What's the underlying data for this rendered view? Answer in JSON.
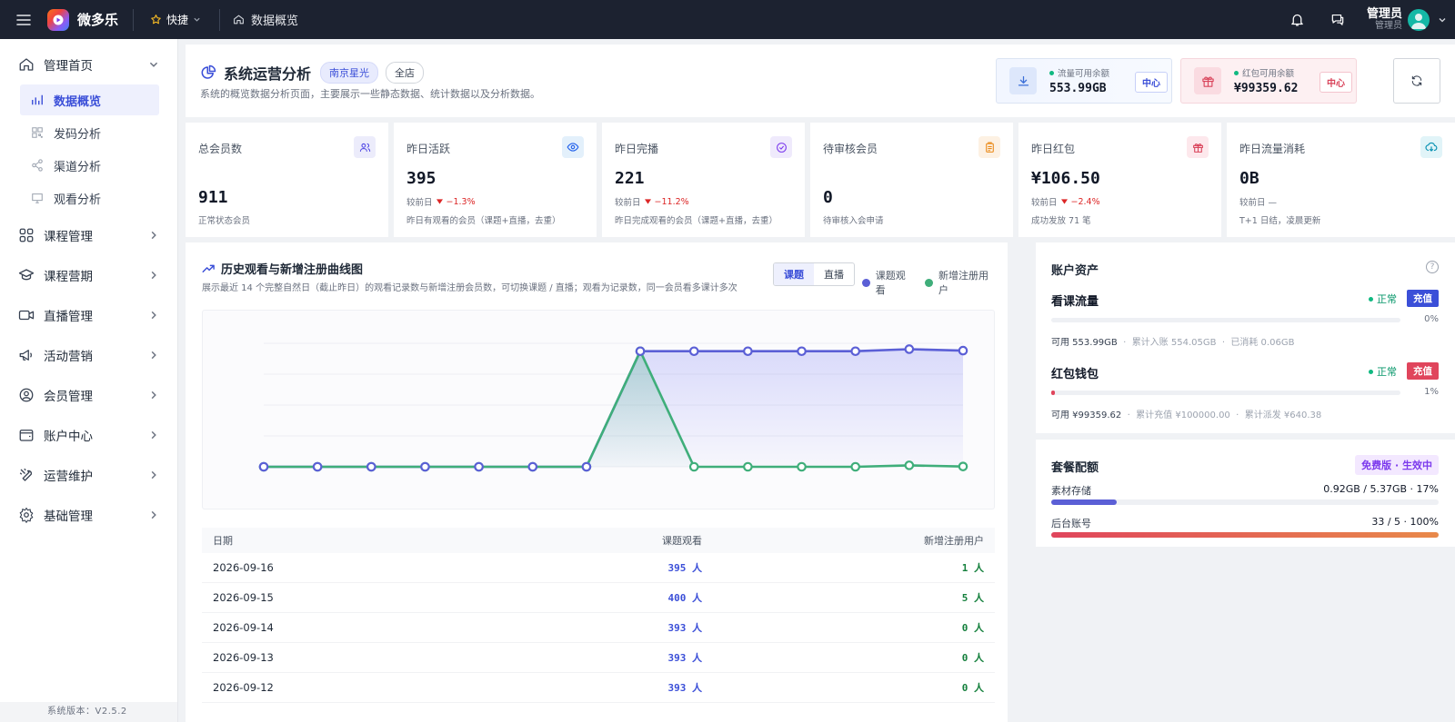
{
  "topbar": {
    "brand": "微多乐",
    "quick": "快捷",
    "breadcrumb": "数据概览",
    "user_name": "管理员",
    "user_role": "管理员"
  },
  "sidebar": {
    "home": "管理首页",
    "sub": [
      "数据概览",
      "发码分析",
      "渠道分析",
      "观看分析"
    ],
    "groups": [
      "课程管理",
      "课程营期",
      "直播管理",
      "活动营销",
      "会员管理",
      "账户中心",
      "运营维护",
      "基础管理"
    ],
    "version": "系统版本：V2.5.2"
  },
  "header": {
    "title": "系统运营分析",
    "store": "南京星光",
    "scope": "全店",
    "desc": "系统的概览数据分析页面，主要展示一些静态数据、统计数据以及分析数据。",
    "flow": {
      "label": "流量可用余额",
      "value": "553.99GB",
      "chip": "中心"
    },
    "redpack": {
      "label": "红包可用余额",
      "value": "¥99359.62",
      "chip": "中心"
    }
  },
  "stats": [
    {
      "label": "总会员数",
      "value": "911",
      "compare": "",
      "delta": "",
      "sub": "正常状态会员"
    },
    {
      "label": "昨日活跃",
      "value": "395",
      "compare": "较前日",
      "delta": "−1.3%",
      "sub": "昨日有观看的会员（课题+直播，去重）"
    },
    {
      "label": "昨日完播",
      "value": "221",
      "compare": "较前日",
      "delta": "−11.2%",
      "sub": "昨日完成观看的会员（课题+直播，去重）"
    },
    {
      "label": "待审核会员",
      "value": "0",
      "compare": "",
      "delta": "",
      "sub": "待审核入会申请"
    },
    {
      "label": "昨日红包",
      "value": "¥106.50",
      "compare": "较前日",
      "delta": "−2.4%",
      "sub": "成功发放 71 笔"
    },
    {
      "label": "昨日流量消耗",
      "value": "0B",
      "compare": "较前日 —",
      "delta": "",
      "sub": "T+1 日结，凌晨更新"
    }
  ],
  "chart": {
    "title": "历史观看与新增注册曲线图",
    "desc": "展示最近 14 个完整自然日（截止昨日）的观看记录数与新增注册会员数，可切换课题 / 直播；观看为记录数，同一会员看多课计多次",
    "tabs": [
      "课题",
      "直播"
    ],
    "legend": [
      "课题观看",
      "新增注册用户"
    ]
  },
  "chart_data": {
    "type": "line",
    "series": [
      {
        "name": "课题观看",
        "color": "#5b5fd6",
        "values": [
          0,
          0,
          0,
          0,
          0,
          0,
          0,
          393,
          393,
          393,
          393,
          393,
          400,
          395
        ]
      },
      {
        "name": "新增注册用户",
        "color": "#3fae7a",
        "values": [
          0,
          0,
          0,
          0,
          0,
          0,
          0,
          393,
          0,
          0,
          0,
          0,
          5,
          1
        ]
      }
    ],
    "ylim": [
      0,
      420
    ],
    "grid": true
  },
  "table": {
    "headers": [
      "日期",
      "课题观看",
      "新增注册用户"
    ],
    "rows": [
      [
        "2026-09-16",
        "395 人",
        "1 人"
      ],
      [
        "2026-09-15",
        "400 人",
        "5 人"
      ],
      [
        "2026-09-14",
        "393 人",
        "0 人"
      ],
      [
        "2026-09-13",
        "393 人",
        "0 人"
      ],
      [
        "2026-09-12",
        "393 人",
        "0 人"
      ]
    ]
  },
  "account": {
    "title": "账户资产",
    "help": "?",
    "flow": {
      "name": "看课流量",
      "status": "正常",
      "btn": "充值",
      "pct": "0%",
      "fill": 0.0,
      "available": "可用 553.99GB",
      "total": "累计入账 554.05GB",
      "used": "已消耗 0.06GB"
    },
    "wallet": {
      "name": "红包钱包",
      "status": "正常",
      "btn": "充值",
      "pct": "1%",
      "fill": 0.01,
      "available": "可用 ¥99359.62",
      "total": "累计充值 ¥100000.00",
      "used": "累计派发 ¥640.38"
    }
  },
  "plan": {
    "title": "套餐配额",
    "badge": "免费版 · 生效中",
    "storage": {
      "label": "素材存储",
      "value": "0.92GB / 5.37GB · 17%",
      "fill": 0.17
    },
    "accounts": {
      "label": "后台账号",
      "value": "33 / 5 · 100%",
      "fill": 1.0
    }
  },
  "colors": {
    "primary": "#3b4fd8",
    "watch": "#5b5fd6",
    "register": "#3fae7a",
    "danger": "#dc2626",
    "topbar": "#1c2230"
  }
}
